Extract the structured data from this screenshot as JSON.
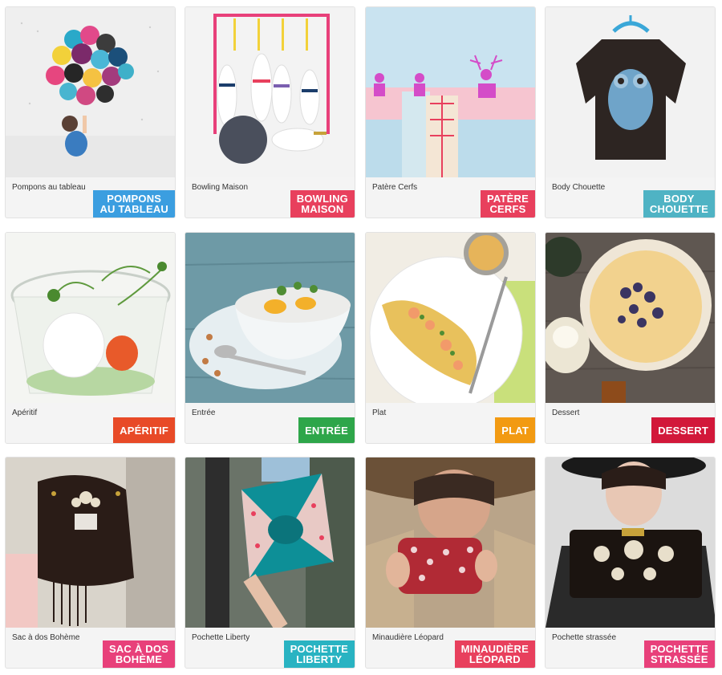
{
  "cards": [
    {
      "caption": "Pompons au tableau",
      "tag": [
        "POMPONS",
        "AU TABLEAU"
      ],
      "color": "#3b9ee0"
    },
    {
      "caption": "Bowling Maison",
      "tag": [
        "BOWLING",
        "MAISON"
      ],
      "color": "#e8405d"
    },
    {
      "caption": "Patère Cerfs",
      "tag": [
        "PATÈRE",
        "CERFS"
      ],
      "color": "#e8405d"
    },
    {
      "caption": "Body Chouette",
      "tag": [
        "BODY",
        "CHOUETTE"
      ],
      "color": "#4fb3c4"
    },
    {
      "caption": "Apéritif",
      "tag": [
        "APÉRITIF"
      ],
      "color": "#e84a27"
    },
    {
      "caption": "Entrée",
      "tag": [
        "ENTRÉE"
      ],
      "color": "#2ea64a"
    },
    {
      "caption": "Plat",
      "tag": [
        "PLAT"
      ],
      "color": "#f29a12"
    },
    {
      "caption": "Dessert",
      "tag": [
        "DESSERT"
      ],
      "color": "#d2183a"
    },
    {
      "caption": "Sac à dos Bohème",
      "tag": [
        "SAC À DOS",
        "BOHÈME"
      ],
      "color": "#e8407a"
    },
    {
      "caption": "Pochette Liberty",
      "tag": [
        "POCHETTE",
        "LIBERTY"
      ],
      "color": "#29b3c2"
    },
    {
      "caption": "Minaudière Léopard",
      "tag": [
        "MINAUDIÈRE",
        "LÉOPARD"
      ],
      "color": "#e8405d"
    },
    {
      "caption": "Pochette strassée",
      "tag": [
        "POCHETTE",
        "STRASSÉE"
      ],
      "color": "#e8407a"
    }
  ]
}
